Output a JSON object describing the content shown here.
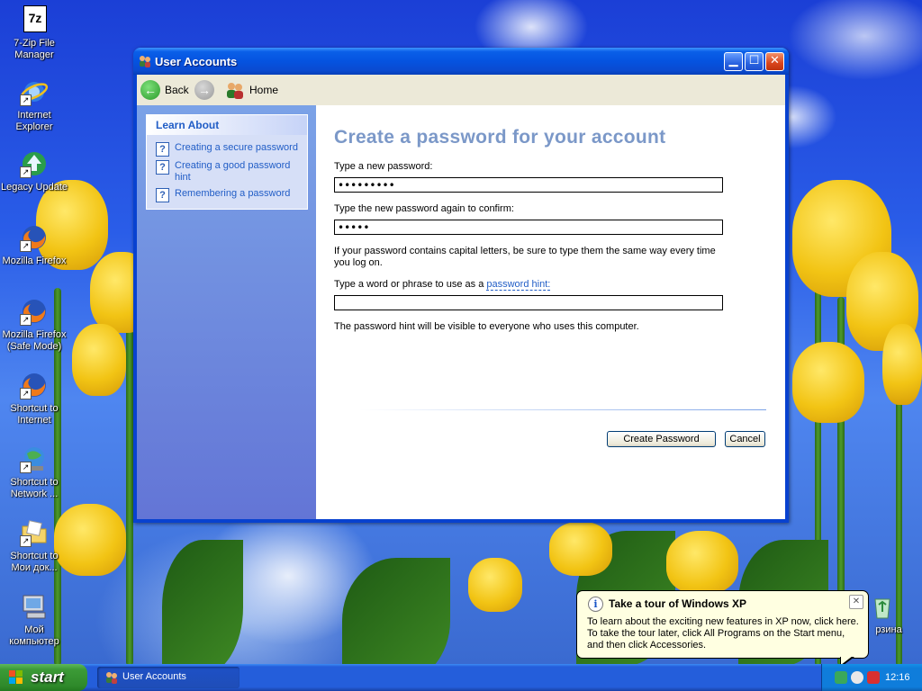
{
  "desktop": {
    "icons": [
      {
        "label": "7-Zip File Manager",
        "icon": "7zip-icon"
      },
      {
        "label": "Internet Explorer",
        "icon": "internet-explorer-icon"
      },
      {
        "label": "Legacy Update",
        "icon": "legacy-update-icon"
      },
      {
        "label": "Mozilla Firefox",
        "icon": "firefox-icon"
      },
      {
        "label": "Mozilla Firefox (Safe Mode)",
        "icon": "firefox-icon"
      },
      {
        "label": "Shortcut to Internet",
        "icon": "firefox-icon"
      },
      {
        "label": "Shortcut to Network ...",
        "icon": "network-icon"
      },
      {
        "label": "Shortcut to Мои док...",
        "icon": "documents-folder-icon"
      },
      {
        "label": "Мой компьютер",
        "icon": "my-computer-icon"
      }
    ],
    "recycle_bin_label": "рзина"
  },
  "window": {
    "title": "User Accounts",
    "toolbar": {
      "back_label": "Back",
      "home_label": "Home"
    },
    "learn_about": {
      "header": "Learn About",
      "items": [
        "Creating a secure password",
        "Creating a good password hint",
        "Remembering a password"
      ]
    },
    "form": {
      "heading": "Create a password for your account",
      "new_password_label": "Type a new password:",
      "new_password_value": "xxxxxxxxx",
      "confirm_label": "Type the new password again to confirm:",
      "confirm_password_value": "xxxxx",
      "capital_note": "If your password contains capital letters, be sure to type them the same way every time you log on.",
      "hint_label_prefix": "Type a word or phrase to use as a ",
      "hint_link": "password hint:",
      "hint_value": "",
      "hint_note": "The password hint will be visible to everyone who uses this computer.",
      "create_button": "Create Password",
      "cancel_button": "Cancel"
    }
  },
  "balloon": {
    "title": "Take a tour of Windows XP",
    "body": "To learn about the exciting new features in XP now, click here. To take the tour later, click All Programs on the Start menu, and then click Accessories."
  },
  "taskbar": {
    "start_label": "start",
    "task_button": "User Accounts",
    "clock": "12:16"
  }
}
